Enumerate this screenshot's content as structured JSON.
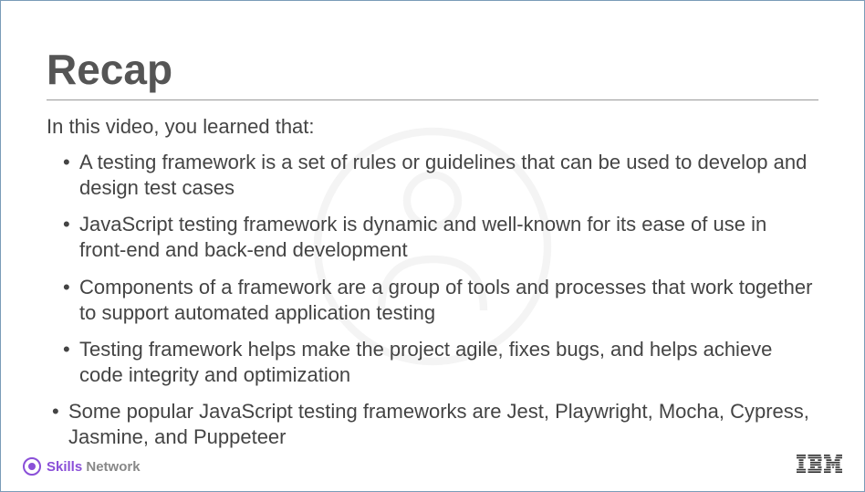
{
  "title": "Recap",
  "intro": "In this video, you learned that:",
  "bullets": [
    "A testing framework is a set of rules or guidelines that can be used to develop and design test cases",
    "JavaScript testing framework is dynamic and well-known for its ease of use in front-end and back-end development",
    "Components of a framework are a group of tools and processes that work together to support automated application testing",
    "Testing framework helps make the project agile, fixes bugs, and helps achieve code integrity and optimization",
    "Some popular JavaScript testing frameworks are Jest, Playwright, Mocha, Cypress, Jasmine, and Puppeteer"
  ],
  "footer": {
    "skills_label_1": "Skills",
    "skills_label_2": " Network",
    "ibm_label": "IBM"
  }
}
